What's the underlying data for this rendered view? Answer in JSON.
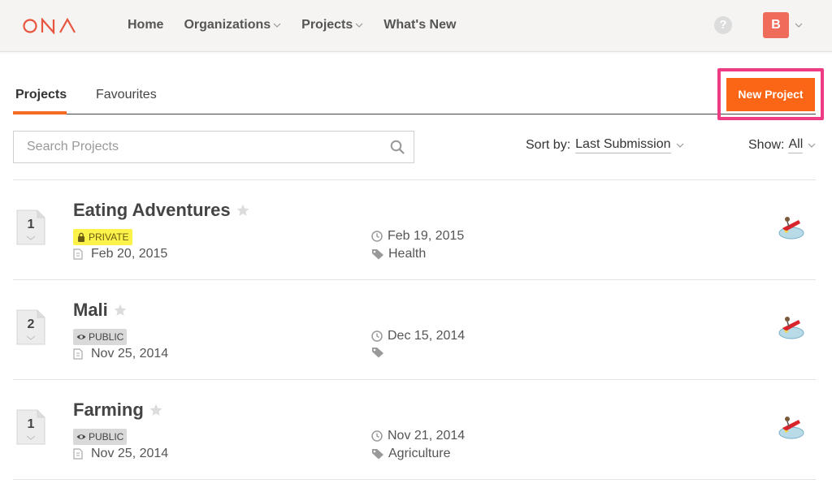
{
  "header": {
    "logo_text": "ONA",
    "nav": [
      {
        "label": "Home",
        "dropdown": false
      },
      {
        "label": "Organizations",
        "dropdown": true
      },
      {
        "label": "Projects",
        "dropdown": true
      },
      {
        "label": "What's New",
        "dropdown": false
      }
    ],
    "help_icon": "question-circle-icon",
    "user_initial": "B"
  },
  "tabs": [
    {
      "label": "Projects",
      "active": true
    },
    {
      "label": "Favourites",
      "active": false
    }
  ],
  "new_project_label": "New Project",
  "search": {
    "placeholder": "Search Projects",
    "value": ""
  },
  "sort": {
    "label": "Sort by:",
    "value": "Last Submission"
  },
  "show": {
    "label": "Show:",
    "value": "All"
  },
  "projects": [
    {
      "count": "1",
      "title": "Eating Adventures",
      "privacy": "PRIVATE",
      "created": "Feb 20, 2015",
      "last_submission": "Feb 19, 2015",
      "tag": "Health"
    },
    {
      "count": "2",
      "title": "Mali",
      "privacy": "PUBLIC",
      "created": "Nov 25, 2014",
      "last_submission": "Dec 15, 2014",
      "tag": ""
    },
    {
      "count": "1",
      "title": "Farming",
      "privacy": "PUBLIC",
      "created": "Nov 25, 2014",
      "last_submission": "Nov 21, 2014",
      "tag": "Agriculture"
    }
  ],
  "colors": {
    "accent": "#fb6516",
    "highlight": "#ef3b83",
    "logo": "#e8553f",
    "private_badge": "#fbf24a",
    "public_badge": "#d9d9d9"
  }
}
